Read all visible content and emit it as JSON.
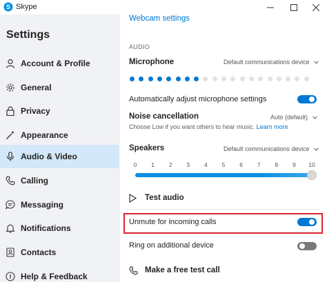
{
  "window": {
    "app_title": "Skype",
    "icons": {
      "app": "skype-icon",
      "minimize": "minimize-icon",
      "maximize": "maximize-icon",
      "close": "close-icon"
    }
  },
  "sidebar": {
    "title": "Settings",
    "items": [
      {
        "label": "Account & Profile",
        "icon": "person-icon",
        "active": false
      },
      {
        "label": "General",
        "icon": "gear-icon",
        "active": false
      },
      {
        "label": "Privacy",
        "icon": "lock-icon",
        "active": false
      },
      {
        "label": "Appearance",
        "icon": "magic-wand-icon",
        "active": false
      },
      {
        "label": "Audio & Video",
        "icon": "microphone-icon",
        "active": true
      },
      {
        "label": "Calling",
        "icon": "phone-icon",
        "active": false
      },
      {
        "label": "Messaging",
        "icon": "chat-icon",
        "active": false
      },
      {
        "label": "Notifications",
        "icon": "bell-icon",
        "active": false
      },
      {
        "label": "Contacts",
        "icon": "contacts-icon",
        "active": false
      },
      {
        "label": "Help & Feedback",
        "icon": "help-icon",
        "active": false
      }
    ]
  },
  "main": {
    "webcam_link": "Webcam settings",
    "audio_heading": "AUDIO",
    "microphone": {
      "label": "Microphone",
      "device": "Default communications device",
      "level_dots_total": 20,
      "level_dots_active": 8
    },
    "auto_adjust": {
      "label": "Automatically adjust microphone settings",
      "on": true
    },
    "noise": {
      "label": "Noise cancellation",
      "value": "Auto (default)",
      "description": "Choose Low if you want others to hear music.",
      "learn_more": "Learn more"
    },
    "speakers": {
      "label": "Speakers",
      "device": "Default communications device",
      "ticks": [
        "0",
        "1",
        "2",
        "3",
        "4",
        "5",
        "6",
        "7",
        "8",
        "9",
        "10"
      ],
      "volume": 10
    },
    "test_audio": "Test audio",
    "unmute_incoming": {
      "label": "Unmute for incoming calls",
      "on": true
    },
    "ring_additional": {
      "label": "Ring on additional device",
      "on": false
    },
    "free_test_call": "Make a free test call"
  },
  "colors": {
    "accent": "#0078d4",
    "highlight_border": "#d9232f",
    "sidebar_bg": "#f1f2f5",
    "sidebar_active": "#d3e8f8",
    "dot_inactive": "#dfe3e8"
  }
}
